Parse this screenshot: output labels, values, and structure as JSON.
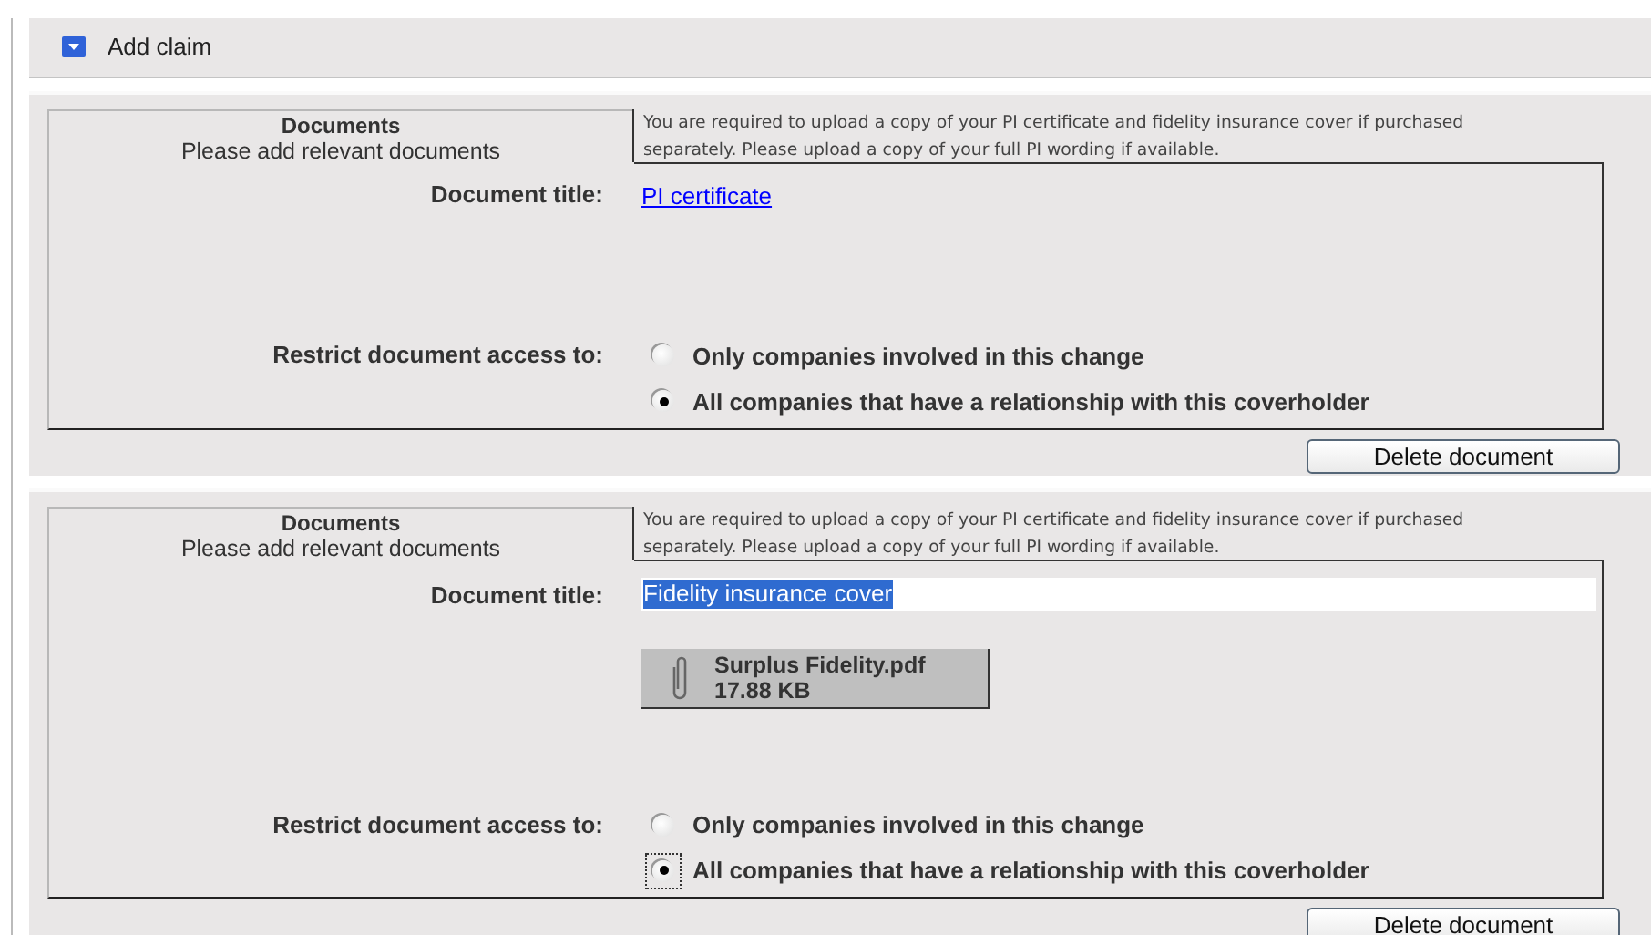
{
  "section": {
    "title": "Add claim",
    "expanded": true
  },
  "documents": [
    {
      "heading": "Documents",
      "subheading": "Please add relevant documents",
      "notice": "You are required to upload a copy of your PI certificate and fidelity insurance cover if purchased separately. Please upload a copy of your full PI wording if available.",
      "title_label": "Document title:",
      "title": {
        "kind": "link",
        "text": "PI certificate"
      },
      "access_label": "Restrict document access to:",
      "options": [
        {
          "label": "Only companies involved in this change",
          "selected": false,
          "focused": false
        },
        {
          "label": "All companies that have a relationship with this coverholder",
          "selected": true,
          "focused": false
        }
      ],
      "delete_button": "Delete document"
    },
    {
      "heading": "Documents",
      "subheading": "Please add relevant documents",
      "notice": "You are required to upload a copy of your PI certificate and fidelity insurance cover if purchased separately. Please upload a copy of your full PI wording if available.",
      "title_label": "Document title:",
      "title": {
        "kind": "field",
        "text": "Fidelity insurance cover"
      },
      "attachment": {
        "name": "Surplus Fidelity.pdf",
        "size": "17.88 KB"
      },
      "access_label": "Restrict document access to:",
      "options": [
        {
          "label": "Only companies involved in this change",
          "selected": false,
          "focused": false
        },
        {
          "label": "All companies that have a relationship with this coverholder",
          "selected": true,
          "focused": true
        }
      ],
      "delete_button": "Delete document"
    }
  ]
}
